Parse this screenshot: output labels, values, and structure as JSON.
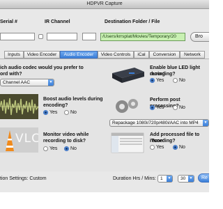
{
  "window": {
    "title": "HDPVR Capture"
  },
  "header": {
    "serial_label": "Serial #",
    "ir_channel_label": "IR Channel",
    "dest_label": "Destination Folder / File",
    "path_value": "/Users/krrsplat/Movies/Temporary/20",
    "browse_label": "Bro"
  },
  "tabs": [
    {
      "label": "Inputs",
      "active": false
    },
    {
      "label": "Video Encoder",
      "active": false
    },
    {
      "label": "Audio Encoder",
      "active": true
    },
    {
      "label": "Video Controls",
      "active": false
    },
    {
      "label": "iCal",
      "active": false
    },
    {
      "label": "Conversion",
      "active": false
    },
    {
      "label": "Network",
      "active": false
    }
  ],
  "audio": {
    "codec_q1": "ich audio codec would you prefer to",
    "codec_q2": "ord with?",
    "codec_value": "Channel AAC",
    "boost_q1": "Boost audio levels during",
    "boost_q2": "encoding?",
    "boost_yes": "Yes",
    "boost_no": "No",
    "monitor_q1": "Monitor video while",
    "monitor_q2": "recording to disk?",
    "monitor_yes": "Yes",
    "monitor_no": "No",
    "vlc_text": "VLC"
  },
  "right": {
    "led_q1": "Enable blue LED light during",
    "led_q2": "recording?",
    "led_yes": "Yes",
    "led_no": "No",
    "post_q": "Perform post processing?",
    "post_yes": "Yes",
    "post_no": "No",
    "repack_value": "Repackage 1080i/720p/480i/AAC into MP4",
    "itunes_q1": "Add processed file to iTune",
    "itunes_q2": "recording?",
    "itunes_yes": "Yes",
    "itunes_no": "No"
  },
  "footer": {
    "status": "tion Settings: Custom",
    "duration_label": "Duration Hrs / Mins:",
    "hrs_value": "1",
    "mins_value": "30",
    "record_label": "Re"
  },
  "colors": {
    "accent": "#3b7fd8",
    "path_bg": "#c8f0b2"
  }
}
